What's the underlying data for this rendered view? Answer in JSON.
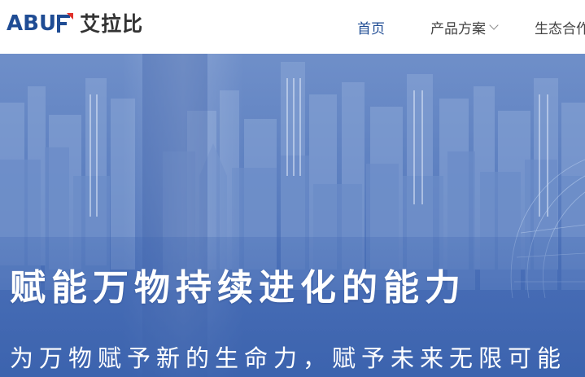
{
  "brand": {
    "logo_text": "ABUF",
    "name_cn": "艾拉比",
    "logo_color": "#1f4c94",
    "logo_accent_color": "#e0302a"
  },
  "nav": {
    "items": [
      {
        "label": "首页",
        "active": true
      },
      {
        "label": "产品方案",
        "has_dropdown": true
      },
      {
        "label": "生态合作"
      }
    ]
  },
  "hero": {
    "title": "赋能万物持续进化的能力",
    "subtitle": "为万物赋予新的生命力，赋予未来无限可能",
    "background_color": "#5c7fc0"
  }
}
